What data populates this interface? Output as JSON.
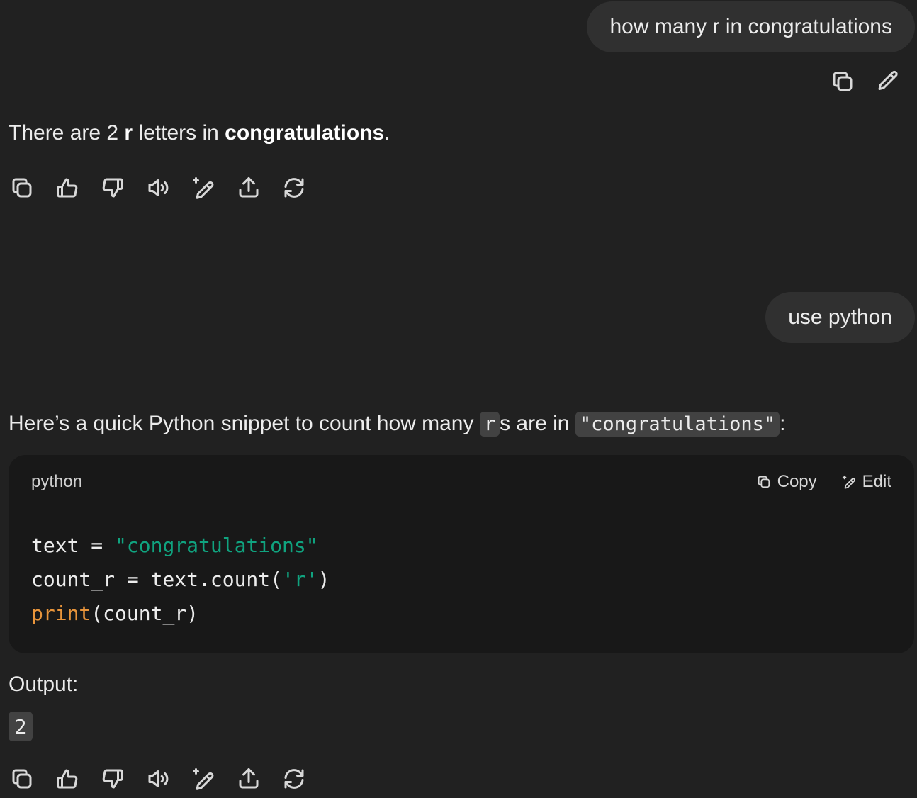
{
  "messages": {
    "user_1": {
      "text": "how many r in congratulations"
    },
    "assistant_1": {
      "prefix": "There are 2 ",
      "bold_1": "r",
      "middle": " letters in ",
      "bold_2": "congratulations",
      "suffix": "."
    },
    "user_2": {
      "text": "use python"
    },
    "assistant_2": {
      "prefix": "Here’s a quick Python snippet to count how many ",
      "code_1": "r",
      "middle": "s are in ",
      "code_2": "\"congratulations\"",
      "suffix": ":",
      "code_block": {
        "language": "python",
        "copy_label": "Copy",
        "edit_label": "Edit",
        "lines": [
          {
            "a": "text = ",
            "str": "\"congratulations\""
          },
          {
            "a": "count_r = text.count(",
            "str": "'r'",
            "b": ")"
          },
          {
            "kw": "print",
            "b": "(count_r)"
          }
        ]
      },
      "output_label": "Output:",
      "output_value": "2"
    }
  },
  "icons": {
    "user_actions": [
      "copy-icon",
      "edit-pencil-icon"
    ],
    "assistant_actions": [
      "copy-icon",
      "thumbs-up-icon",
      "thumbs-down-icon",
      "read-aloud-icon",
      "edit-sparkle-icon",
      "share-icon",
      "regenerate-icon"
    ]
  },
  "colors": {
    "background": "#212121",
    "user_bubble": "#303030",
    "code_bg": "#181818",
    "string": "#10a37f",
    "keyword": "#e9953b"
  }
}
